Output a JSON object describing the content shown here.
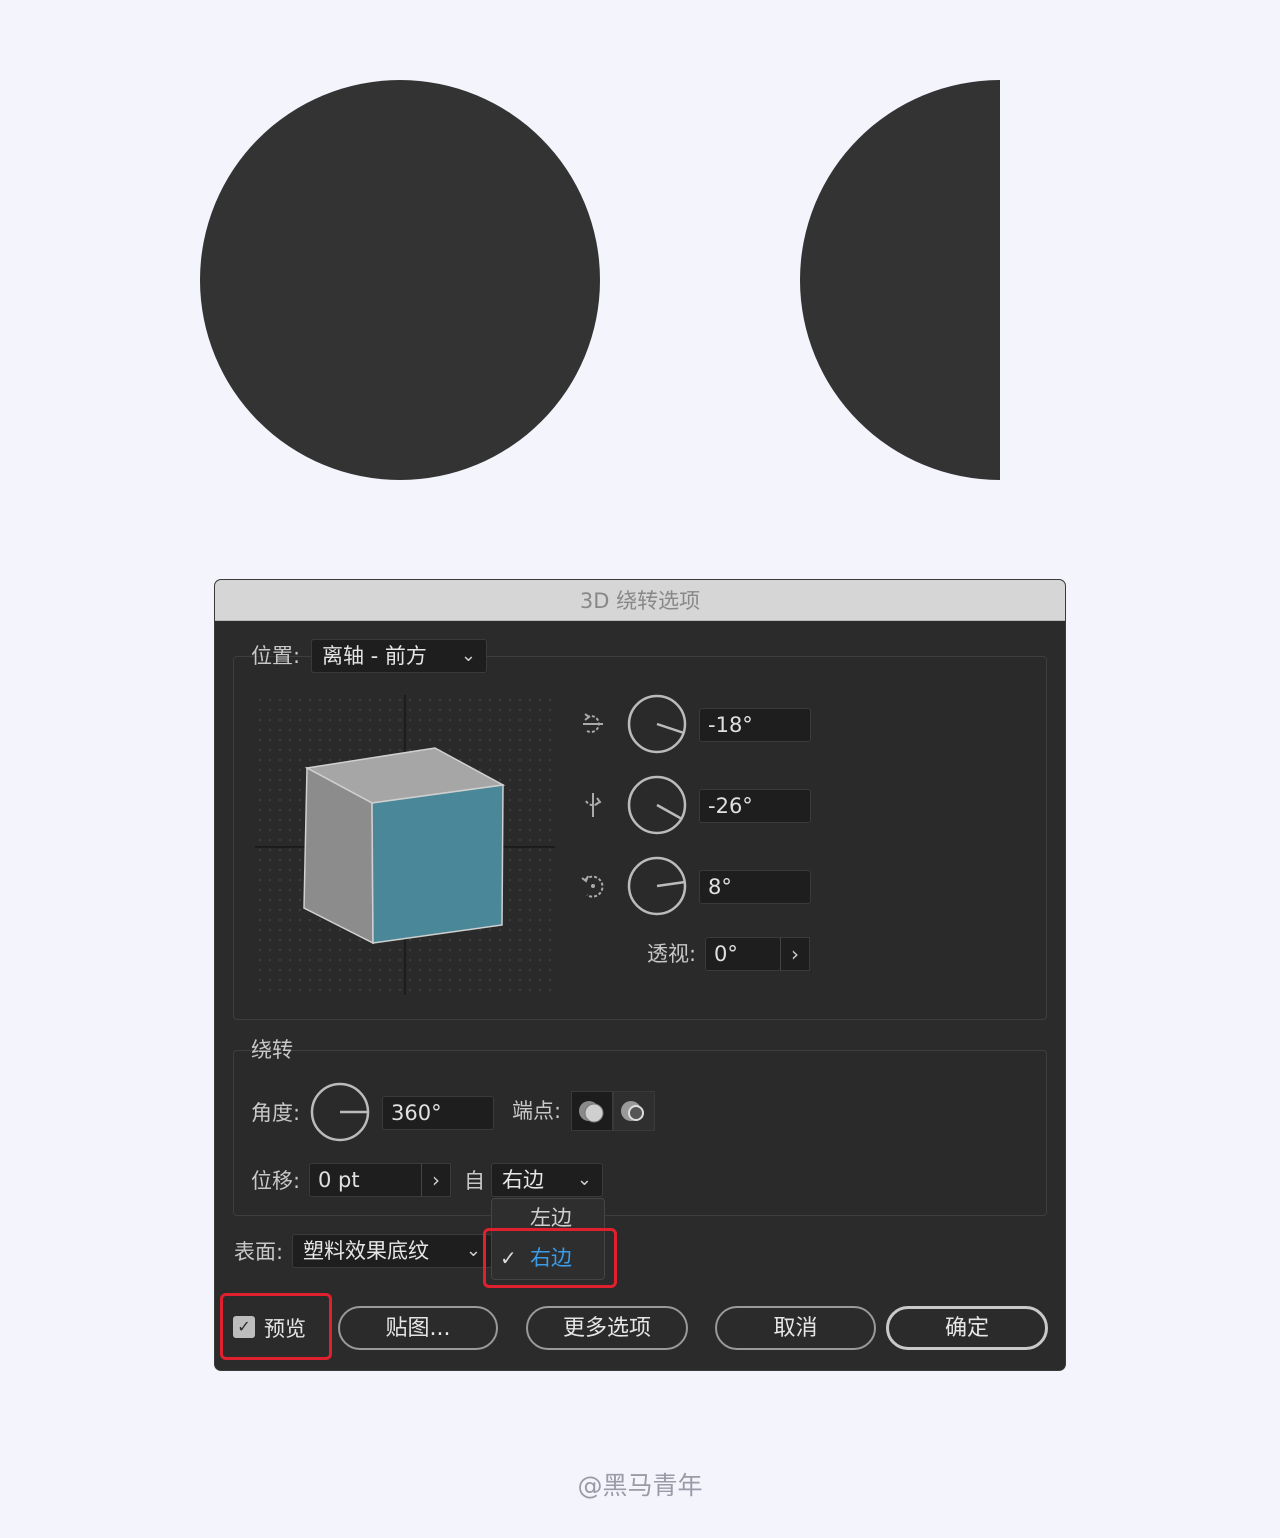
{
  "dialog": {
    "title": "3D 绕转选项",
    "position": {
      "label": "位置:",
      "selected": "离轴 - 前方",
      "rotations": [
        {
          "icon": "rotate-x-axis-icon",
          "value": "-18°"
        },
        {
          "icon": "rotate-y-axis-icon",
          "value": "-26°"
        },
        {
          "icon": "rotate-z-axis-icon",
          "value": "8°"
        }
      ],
      "perspective_label": "透视:",
      "perspective_value": "0°"
    },
    "revolve": {
      "title": "绕转",
      "angle_label": "角度:",
      "angle_value": "360°",
      "cap_label": "端点:",
      "offset_label": "位移:",
      "offset_value": "0 pt",
      "from_label": "自",
      "from_selected": "右边",
      "from_options": [
        "左边",
        "右边"
      ]
    },
    "surface": {
      "label": "表面:",
      "selected": "塑料效果底纹"
    },
    "preview": {
      "label": "预览",
      "checked": true
    },
    "buttons": {
      "map": "贴图...",
      "more": "更多选项",
      "cancel": "取消",
      "ok": "确定"
    }
  },
  "watermark": "@黑马青年",
  "colors": {
    "artwork": "#333333",
    "dialog_bg": "#2b2b2b",
    "cube_front": "#4a8798",
    "highlight": "#e0202c",
    "menu_selected": "#3b9be8"
  }
}
